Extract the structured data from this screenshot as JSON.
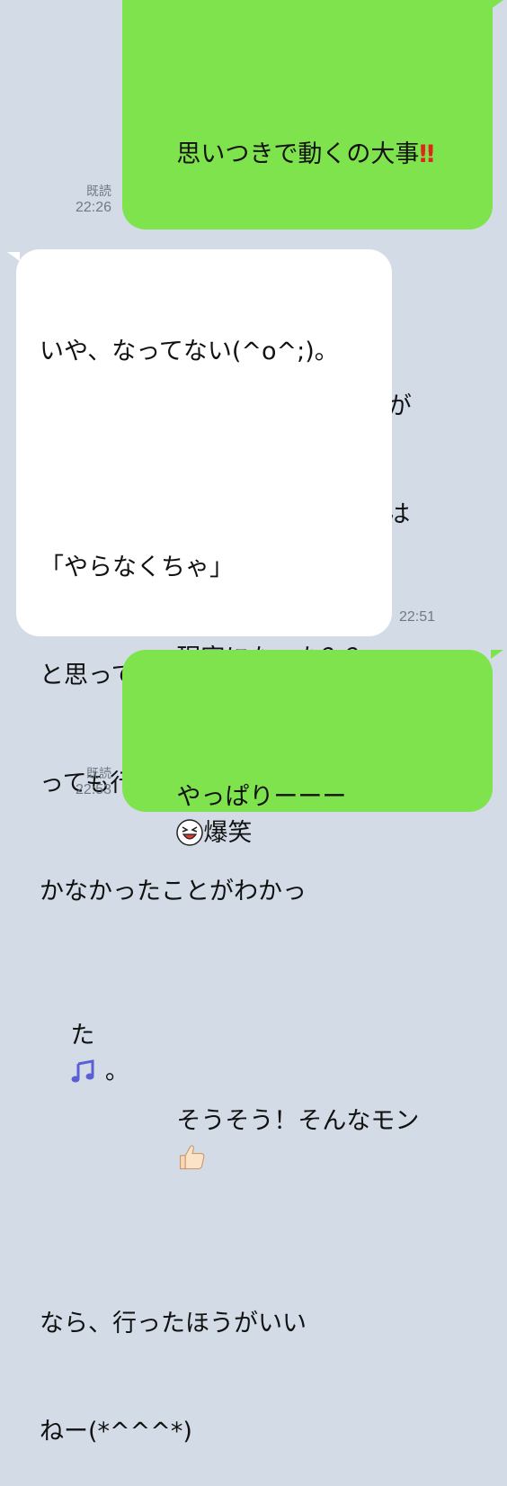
{
  "messages": [
    {
      "direction": "outgoing",
      "read_label": "既読",
      "time": "22:26",
      "lines": [
        "思いつきで動くの大事",
        "",
        "で、銭湯行くのを不安が",
        "ってたけど、その不安は",
        "現実になった？？"
      ],
      "icons": [
        "double-exclamation-icon",
        "grinning-face-icon"
      ]
    },
    {
      "direction": "incoming",
      "time": "22:51",
      "lines": [
        "いや、なってない(^o^;)。",
        "",
        "「やらなくちゃ」",
        "と思ってたことは銭湯行",
        "っても行かなくても片付",
        "かなかったことがわかっ",
        "た",
        "",
        "なら、行ったほうがいい",
        "ねー(*^^^*)"
      ],
      "icons": [
        "music-note-icon"
      ],
      "line7_suffix": " 。"
    },
    {
      "direction": "outgoing",
      "read_label": "既読",
      "time": "22:53",
      "lines": [
        "やっぱりーーー",
        "",
        "そうそう！そんなモン"
      ],
      "line1_suffix": "爆笑",
      "icons": [
        "laughing-face-icon",
        "thumbs-up-icon"
      ]
    }
  ],
  "colors": {
    "background": "#d3dce6",
    "outgoing_bubble": "#7fe34d",
    "incoming_bubble": "#ffffff",
    "meta_text": "#6f7a85"
  }
}
